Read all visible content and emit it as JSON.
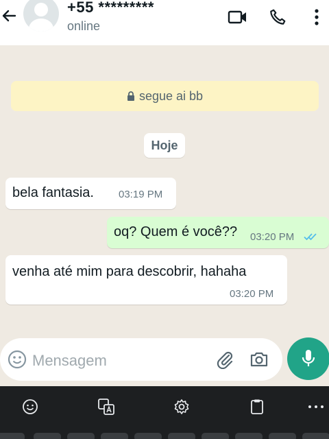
{
  "header": {
    "contact_name": "+55 *********",
    "status": "online"
  },
  "chat": {
    "encryption_notice": "segue ai bb",
    "date_chip": "Hoje",
    "messages": [
      {
        "direction": "in",
        "text": "bela fantasia.",
        "time": "03:19 PM"
      },
      {
        "direction": "out",
        "text": "oq? Quem é você??",
        "time": "03:20 PM",
        "read": true
      },
      {
        "direction": "in",
        "text": "venha até mim para descobrir, hahaha",
        "time": "03:20 PM"
      }
    ]
  },
  "composer": {
    "placeholder": "Mensagem"
  },
  "colors": {
    "header_bg": "#ffffff",
    "chat_bg": "#efeae2",
    "incoming_bubble": "#ffffff",
    "outgoing_bubble": "#d9fdd3",
    "accent": "#21a488",
    "read_ticks": "#53bdeb",
    "keyboard_bg": "#1d1f21"
  },
  "icons": {
    "header": [
      "arrow-left-icon",
      "video-call-icon",
      "phone-icon",
      "more-vertical-icon"
    ],
    "composer": [
      "emoji-icon",
      "attach-icon",
      "camera-icon",
      "mic-icon"
    ],
    "keyboard_toolbar": [
      "emoji-icon",
      "translate-icon",
      "settings-icon",
      "clipboard-icon",
      "more-horizontal-icon"
    ]
  }
}
